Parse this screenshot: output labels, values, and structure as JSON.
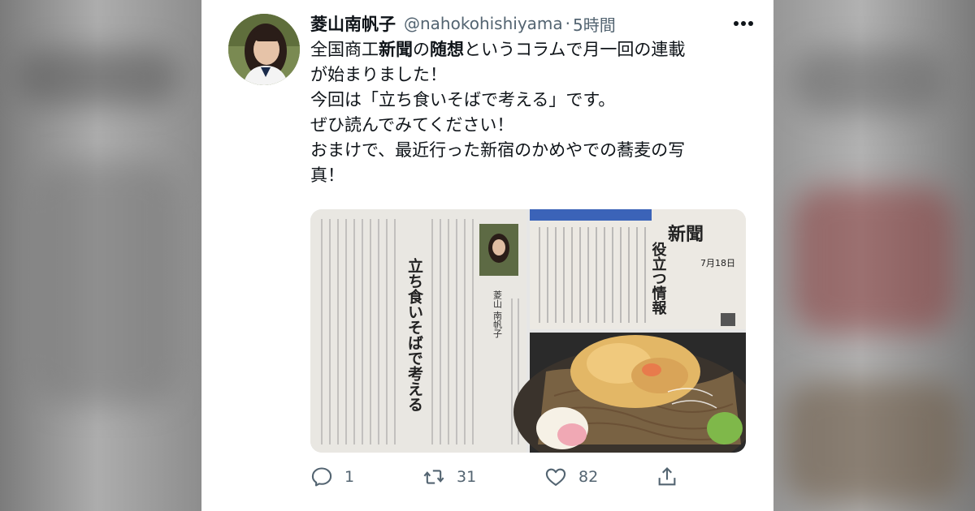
{
  "tweet": {
    "author_name": "菱山南帆子",
    "author_handle": "@nahokohishiyama",
    "separator": "·",
    "time": "5時間",
    "text_lines": [
      [
        "全国商工",
        "新聞",
        "の",
        "随想",
        "というコラムで月一回の連載"
      ],
      [
        "が始まりました！"
      ],
      [
        "今回は「立ち食いそばで考える」です。"
      ],
      [
        "ぜひ読んでみてください！"
      ],
      [
        "おまけで、最近行った新宿のかめやでの蕎麦の写"
      ],
      [
        "真！"
      ]
    ]
  },
  "media": {
    "left_image": {
      "headline": "立ち食いそばで考える",
      "byline": "菱山 南帆子"
    },
    "top_right_image": {
      "masthead": "新聞",
      "date": "7月18日",
      "headline": "役立つ情報"
    },
    "bottom_right_image": {}
  },
  "actions": {
    "reply_count": "1",
    "retweet_count": "31",
    "like_count": "82"
  },
  "colors": {
    "text": "#0f1419",
    "secondary": "#536471",
    "background_blur": "#9a9a9a"
  }
}
